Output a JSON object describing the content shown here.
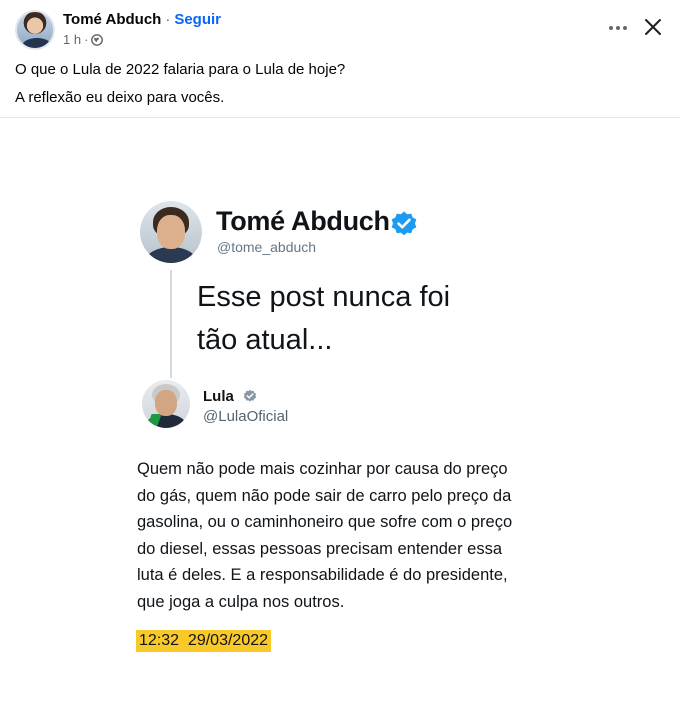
{
  "header": {
    "author": "Tomé Abduch",
    "separator": "·",
    "follow_label": "Seguir",
    "time": "1 h",
    "time_sep": "·"
  },
  "caption": {
    "line1": "O que o Lula de 2022 falaria para o Lula de hoje?",
    "line2": "A reflexão eu deixo para vocês."
  },
  "image": {
    "tweet": {
      "name": "Tomé Abduch",
      "handle": "@tome_abduch",
      "text_line1": "Esse post nunca foi",
      "text_line2": "tão atual..."
    },
    "quoted": {
      "name": "Lula",
      "handle": "@LulaOficial",
      "lines": [
        "Quem não pode mais cozinhar por causa do preço",
        "do gás, quem não pode sair de carro pelo preço da",
        "gasolina, ou o caminhoneiro que sofre com o preço",
        "do diesel, essas pessoas precisam entender essa",
        "luta é deles. E a responsabilidade é do presidente,",
        "que joga a culpa nos outros."
      ],
      "timestamp": "12:32  29/03/2022"
    }
  },
  "colors": {
    "link": "#0866ff",
    "verified": "#1d9bf0",
    "highlight": "#f9c929",
    "muted": "#65676b"
  },
  "icons": [
    "globe-icon",
    "more-icon",
    "close-icon",
    "verified-icon",
    "gray-verified-icon"
  ]
}
